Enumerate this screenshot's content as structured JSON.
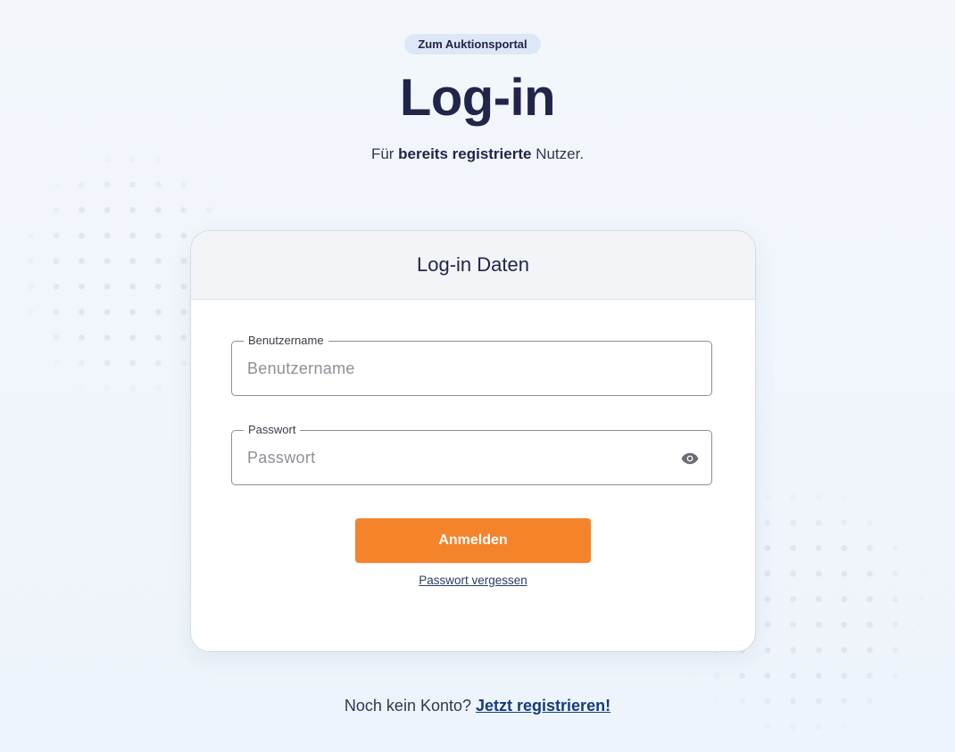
{
  "top_link": {
    "label": "Zum Auktionsportal"
  },
  "page": {
    "title": "Log-in",
    "subtitle_prefix": "Für ",
    "subtitle_bold": "bereits registrierte",
    "subtitle_suffix": " Nutzer."
  },
  "card": {
    "title": "Log-in Daten",
    "username": {
      "label": "Benutzername",
      "placeholder": "Benutzername",
      "value": ""
    },
    "password": {
      "label": "Passwort",
      "placeholder": "Passwort",
      "value": ""
    },
    "submit_label": "Anmelden",
    "forgot_label": "Passwort vergessen"
  },
  "footer": {
    "prompt": "Noch kein Konto?",
    "register_label": "Jetzt registrieren!"
  },
  "icons": {
    "password_toggle": "eye-icon"
  },
  "colors": {
    "accent": "#f5832a",
    "title": "#22254a",
    "link": "#153d7a",
    "pill_bg": "#dce7f8"
  }
}
